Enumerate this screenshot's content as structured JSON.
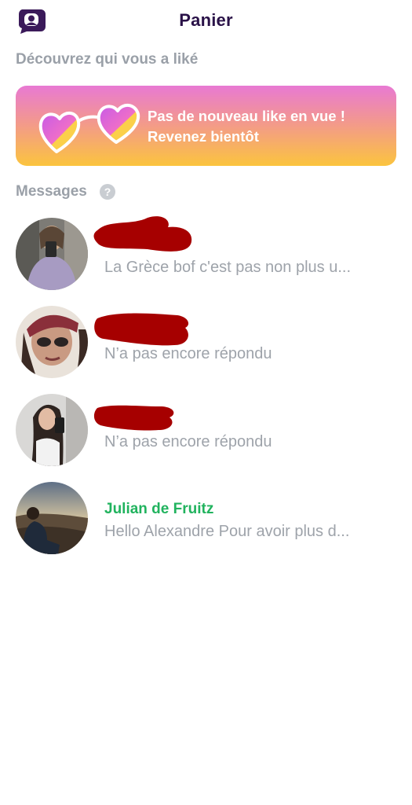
{
  "header": {
    "title": "Panier",
    "logo_icon": "chat-bubble-logo-icon"
  },
  "likes_section": {
    "title": "Découvrez qui vous a liké",
    "card": {
      "line1": "Pas de nouveau like en vue !",
      "line2": "Revenez bientôt",
      "icon": "heart-glasses-icon"
    }
  },
  "messages_section": {
    "title": "Messages",
    "help_icon": "?"
  },
  "conversations": [
    {
      "name": "",
      "name_redacted": true,
      "preview": "La Grèce bof c'est pas non plus u..."
    },
    {
      "name": "",
      "name_redacted": true,
      "preview": "N’a pas encore répondu"
    },
    {
      "name": "",
      "name_redacted": true,
      "preview": "N’a pas encore répondu"
    },
    {
      "name": "Julian de Fruitz",
      "name_redacted": false,
      "preview": "Hello Alexandre Pour avoir plus d..."
    }
  ],
  "colors": {
    "title": "#2a1248",
    "section": "#9aa0a8",
    "preview": "#9ea3aa",
    "name_green": "#21b35e",
    "redaction": "#a60000",
    "card_gradient_top": "#e879d3",
    "card_gradient_bottom": "#fbc43e"
  }
}
